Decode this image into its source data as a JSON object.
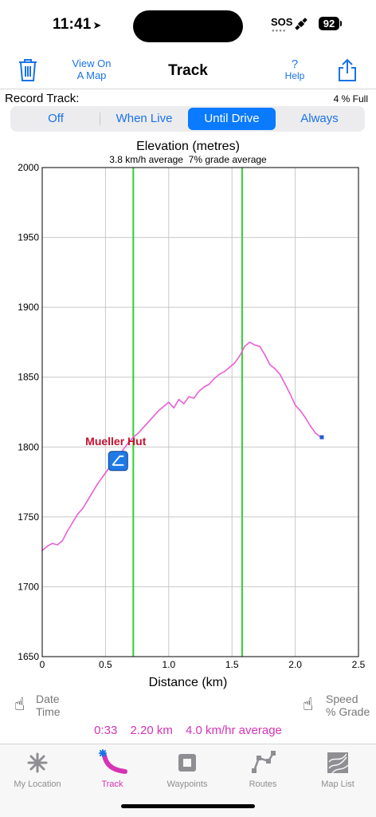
{
  "status": {
    "time": "11:41",
    "sos": "SOS",
    "battery": "92"
  },
  "nav": {
    "title": "Track",
    "view_map_line1": "View On",
    "view_map_line2": "A Map",
    "help_symbol": "?",
    "help_label": "Help",
    "trash_icon": "trash-icon",
    "share_icon": "share-icon"
  },
  "record": {
    "label": "Record Track:",
    "storage": "4 % Full",
    "options": [
      "Off",
      "When Live",
      "Until Drive",
      "Always"
    ],
    "selected": "Until Drive"
  },
  "chart_data": {
    "type": "line",
    "title": "Elevation (metres)",
    "subtitle": "3.8 km/h average  7% grade average",
    "xlabel": "Distance (km)",
    "ylabel": "",
    "xlim": [
      0,
      2.5
    ],
    "ylim": [
      1650,
      2000
    ],
    "xticks": [
      "0",
      "0.5",
      "1.0",
      "1.5",
      "2.0",
      "2.5"
    ],
    "yticks": [
      "1650",
      "1700",
      "1750",
      "1800",
      "1850",
      "1900",
      "1950",
      "2000"
    ],
    "grid": true,
    "series": [
      {
        "color": "#e85fd6",
        "x": [
          0,
          0.04,
          0.08,
          0.12,
          0.16,
          0.2,
          0.24,
          0.28,
          0.32,
          0.36,
          0.4,
          0.44,
          0.48,
          0.52,
          0.56,
          0.6,
          0.64,
          0.68,
          0.72,
          0.76,
          0.8,
          0.84,
          0.88,
          0.92,
          0.96,
          1.0,
          1.04,
          1.08,
          1.12,
          1.16,
          1.2,
          1.24,
          1.28,
          1.32,
          1.36,
          1.4,
          1.44,
          1.48,
          1.52,
          1.56,
          1.6,
          1.64,
          1.68,
          1.72,
          1.76,
          1.8,
          1.84,
          1.88,
          1.92,
          1.96,
          2.0,
          2.04,
          2.08,
          2.12,
          2.16,
          2.2
        ],
        "y": [
          1726,
          1729,
          1731,
          1730,
          1733,
          1740,
          1746,
          1752,
          1756,
          1762,
          1768,
          1774,
          1779,
          1784,
          1788,
          1793,
          1798,
          1803,
          1807,
          1810,
          1814,
          1818,
          1822,
          1826,
          1829,
          1832,
          1828,
          1834,
          1831,
          1836,
          1835,
          1840,
          1843,
          1845,
          1849,
          1852,
          1854,
          1857,
          1860,
          1865,
          1872,
          1875,
          1873,
          1872,
          1866,
          1859,
          1856,
          1852,
          1845,
          1838,
          1830,
          1826,
          1821,
          1815,
          1810,
          1807
        ]
      }
    ],
    "vlines": [
      0.72,
      1.58
    ],
    "end_marker": {
      "x": 2.21,
      "y": 1807
    },
    "waypoint": {
      "label": "Mueller Hut",
      "x": 0.6,
      "y": 1790,
      "icon": "hut-waypoint-icon"
    },
    "colors": {
      "track": "#e85fd6",
      "vline": "#2ed12e",
      "grid": "#c8c8c8",
      "waypoint_label": "#c8102e",
      "end_marker": "#1f5fd0"
    }
  },
  "footer": {
    "left_line1": "Date",
    "left_line2": "Time",
    "right_line1": "Speed",
    "right_line2": "% Grade",
    "duration": "0:33",
    "distance": "2.20 km",
    "speed": "4.0 km/hr average"
  },
  "tabs": [
    {
      "label": "My Location",
      "icon": "my-location-icon"
    },
    {
      "label": "Track",
      "icon": "track-icon"
    },
    {
      "label": "Waypoints",
      "icon": "waypoints-icon"
    },
    {
      "label": "Routes",
      "icon": "routes-icon"
    },
    {
      "label": "Map List",
      "icon": "map-list-icon"
    }
  ],
  "active_tab": "Track"
}
